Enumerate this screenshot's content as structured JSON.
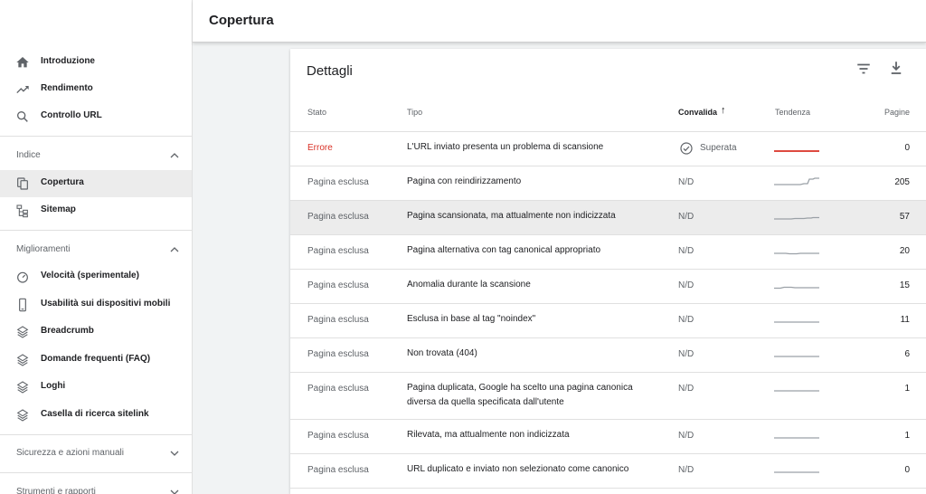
{
  "header": {
    "title": "Copertura"
  },
  "sidebar": {
    "top_items": [
      {
        "label": "Introduzione",
        "icon": "home-icon"
      },
      {
        "label": "Rendimento",
        "icon": "trending-up-icon"
      },
      {
        "label": "Controllo URL",
        "icon": "search-icon"
      }
    ],
    "sections": [
      {
        "label": "Indice",
        "expanded": true
      },
      {
        "label": "Miglioramenti",
        "expanded": true
      },
      {
        "label": "Sicurezza e azioni manuali",
        "expanded": false
      },
      {
        "label": "Strumenti e rapporti",
        "expanded": false
      }
    ],
    "index_items": [
      {
        "label": "Copertura",
        "icon": "copy-icon",
        "active": true
      },
      {
        "label": "Sitemap",
        "icon": "sitemap-icon"
      }
    ],
    "improvement_items": [
      {
        "label": "Velocità (sperimentale)",
        "icon": "gauge-icon"
      },
      {
        "label": "Usabilità sui dispositivi mobili",
        "icon": "smartphone-icon"
      },
      {
        "label": "Breadcrumb",
        "icon": "layers-icon"
      },
      {
        "label": "Domande frequenti (FAQ)",
        "icon": "layers-icon"
      },
      {
        "label": "Loghi",
        "icon": "layers-icon"
      },
      {
        "label": "Casella di ricerca sitelink",
        "icon": "layers-icon"
      }
    ]
  },
  "details": {
    "title": "Dettagli",
    "columns": {
      "stato": "Stato",
      "tipo": "Tipo",
      "convalida": "Convalida",
      "tendenza": "Tendenza",
      "pagine": "Pagine"
    },
    "sort_indicator": "↑",
    "rows": [
      {
        "stato": "Errore",
        "tipo": "L'URL inviato presenta un problema di scansione",
        "tipo2": "",
        "convalida": "Superata",
        "pagine": "0"
      },
      {
        "stato": "Pagina esclusa",
        "tipo": "Pagina con reindirizzamento",
        "tipo2": "",
        "convalida": "N/D",
        "pagine": "205"
      },
      {
        "stato": "Pagina esclusa",
        "tipo": "Pagina scansionata, ma attualmente non indicizzata",
        "tipo2": "",
        "convalida": "N/D",
        "pagine": "57"
      },
      {
        "stato": "Pagina esclusa",
        "tipo": "Pagina alternativa con tag canonical appropriato",
        "tipo2": "",
        "convalida": "N/D",
        "pagine": "20"
      },
      {
        "stato": "Pagina esclusa",
        "tipo": "Anomalia durante la scansione",
        "tipo2": "",
        "convalida": "N/D",
        "pagine": "15"
      },
      {
        "stato": "Pagina esclusa",
        "tipo": "Esclusa in base al tag \"noindex\"",
        "tipo2": "",
        "convalida": "N/D",
        "pagine": "11"
      },
      {
        "stato": "Pagina esclusa",
        "tipo": "Non trovata (404)",
        "tipo2": "",
        "convalida": "N/D",
        "pagine": "6"
      },
      {
        "stato": "Pagina esclusa",
        "tipo": "Pagina duplicata, Google ha scelto una pagina canonica",
        "tipo2": "diversa da quella specificata dall'utente",
        "convalida": "N/D",
        "pagine": "1"
      },
      {
        "stato": "Pagina esclusa",
        "tipo": "Rilevata, ma attualmente non indicizzata",
        "tipo2": "",
        "convalida": "N/D",
        "pagine": "1"
      },
      {
        "stato": "Pagina esclusa",
        "tipo": "URL duplicato e inviato non selezionato come canonico",
        "tipo2": "",
        "convalida": "N/D",
        "pagine": "0"
      }
    ]
  },
  "colors": {
    "error": "#d93025",
    "sparkline": "#9aa0a6",
    "sparkline_error": "#d93025"
  }
}
